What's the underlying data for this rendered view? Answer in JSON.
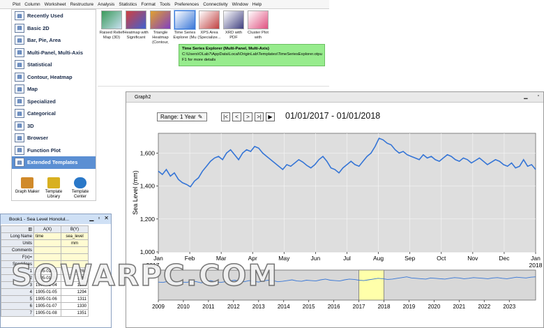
{
  "menu": [
    "Plot",
    "Column",
    "Worksheet",
    "Restructure",
    "Analysis",
    "Statistics",
    "Format",
    "Tools",
    "Preferences",
    "Connectivity",
    "Window",
    "Help"
  ],
  "categories": [
    {
      "label": "Recently Used",
      "icon": "recent-icon"
    },
    {
      "label": "Basic 2D",
      "icon": "basic2d-icon"
    },
    {
      "label": "Bar, Pie, Area",
      "icon": "bar-icon"
    },
    {
      "label": "Multi-Panel, Multi-Axis",
      "icon": "multipanel-icon"
    },
    {
      "label": "Statistical",
      "icon": "statistical-icon"
    },
    {
      "label": "Contour, Heatmap",
      "icon": "contour-icon"
    },
    {
      "label": "Map",
      "icon": "map-icon"
    },
    {
      "label": "Specialized",
      "icon": "specialized-icon"
    },
    {
      "label": "Categorical",
      "icon": "categorical-icon"
    },
    {
      "label": "3D",
      "icon": "3d-icon"
    },
    {
      "label": "Browser",
      "icon": "browser-icon"
    },
    {
      "label": "Function Plot",
      "icon": "function-icon"
    },
    {
      "label": "Extended Templates",
      "icon": "templates-icon",
      "selected": true
    }
  ],
  "bottom_buttons": [
    {
      "label": "Graph Maker",
      "icon": "graph-maker-icon"
    },
    {
      "label": "Template Library",
      "icon": "template-library-icon"
    },
    {
      "label": "Template Center",
      "icon": "template-center-icon"
    }
  ],
  "templates": [
    {
      "label": "Raised Relief Map (3D)"
    },
    {
      "label": "Heatmap with Significant"
    },
    {
      "label": "Triangle Heatmap (Contour,"
    },
    {
      "label": "Time Series Explorer (Mu",
      "selected": true
    },
    {
      "label": "XPS Area (Specialize..."
    },
    {
      "label": "XRD with PDF"
    },
    {
      "label": "Cluster Plot with"
    }
  ],
  "tooltip": {
    "title": "Time Series Explorer (Multi-Panel, Multi-Axis)",
    "path": "C:\\Users\\OLab7\\AppData\\Local\\OriginLab\\Templates\\TimeSeriesExplorer.otpu",
    "help": "F1 for more details"
  },
  "graph": {
    "title": "Graph2",
    "range_label": "Range: 1 Year",
    "date_range": "01/01/2017 - 01/01/2018",
    "nav": [
      "|<",
      "<",
      ">",
      ">|",
      "▶"
    ]
  },
  "colors": {
    "line": "#3575d6",
    "selected_cat": "#5b8fd3",
    "tooltip": "#97ec8d",
    "overview_bg": "#d8d8d8",
    "highlight": "#ffffaa"
  },
  "chart_data": [
    {
      "type": "line",
      "ylabel": "Sea Level (mm)",
      "ylim": [
        1000,
        1720
      ],
      "yticks": [
        "1,000",
        "1,200",
        "1,400",
        "1,600"
      ],
      "ytick_values": [
        1000,
        1200,
        1400,
        1600
      ],
      "x_month_labels": [
        "Jan",
        "Feb",
        "Mar",
        "Apr",
        "May",
        "Jun",
        "Jul",
        "Aug",
        "Sep",
        "Oct",
        "Nov",
        "Dec",
        "Jan"
      ],
      "x_corner_labels": {
        "left": "2017",
        "right": "2018"
      },
      "series": [
        {
          "values": [
            1490,
            1470,
            1500,
            1460,
            1480,
            1440,
            1420,
            1410,
            1395,
            1430,
            1450,
            1490,
            1520,
            1550,
            1570,
            1580,
            1560,
            1600,
            1620,
            1590,
            1560,
            1600,
            1620,
            1610,
            1640,
            1630,
            1600,
            1580,
            1560,
            1540,
            1520,
            1500,
            1530,
            1520,
            1540,
            1560,
            1545,
            1525,
            1510,
            1530,
            1560,
            1580,
            1550,
            1510,
            1500,
            1480,
            1510,
            1530,
            1550,
            1530,
            1520,
            1550,
            1580,
            1600,
            1640,
            1690,
            1680,
            1660,
            1650,
            1620,
            1600,
            1610,
            1590,
            1580,
            1570,
            1560,
            1590,
            1570,
            1580,
            1560,
            1550,
            1570,
            1590,
            1580,
            1560,
            1550,
            1570,
            1560,
            1540,
            1555,
            1570,
            1550,
            1530,
            1545,
            1560,
            1550,
            1530,
            1520,
            1540,
            1510,
            1520,
            1560,
            1520,
            1530,
            1500
          ]
        }
      ]
    },
    {
      "type": "line",
      "x_year_labels": [
        "2009",
        "2010",
        "2011",
        "2012",
        "2013",
        "2014",
        "2015",
        "2016",
        "2017",
        "2018",
        "2019",
        "2020",
        "2021",
        "2022",
        "2023"
      ],
      "highlight": {
        "from": 2017,
        "to": 2018
      },
      "ylim": [
        1000,
        1800
      ],
      "series": [
        {
          "values": [
            1480,
            1470,
            1500,
            1490,
            1460,
            1480,
            1470,
            1510,
            1490,
            1460,
            1500,
            1520,
            1480,
            1470,
            1490,
            1510,
            1530,
            1500,
            1490,
            1520,
            1500,
            1480,
            1510,
            1530,
            1520,
            1490,
            1500,
            1520,
            1540,
            1510,
            1500,
            1530,
            1520,
            1510,
            1540,
            1560,
            1530,
            1520,
            1510,
            1540,
            1560,
            1550,
            1530,
            1520,
            1540,
            1560,
            1580,
            1570,
            1550,
            1560,
            1580,
            1600,
            1620,
            1590,
            1580,
            1570,
            1560,
            1590,
            1580,
            1570,
            1560,
            1580,
            1600,
            1590,
            1570,
            1580,
            1600,
            1590,
            1580,
            1570,
            1590,
            1600,
            1580,
            1570,
            1590,
            1610,
            1600,
            1590,
            1610,
            1620
          ]
        }
      ]
    }
  ],
  "book": {
    "title": "Book1 - Sea Level Honolul...",
    "col_headers": [
      "A(X)",
      "B(Y)"
    ],
    "meta_rows": [
      {
        "label": "Long Name",
        "a": "time",
        "b": "sea_level"
      },
      {
        "label": "Units",
        "a": "",
        "b": "mm"
      },
      {
        "label": "Comments",
        "a": "",
        "b": ""
      },
      {
        "label": "F(x)=",
        "a": "",
        "b": ""
      },
      {
        "label": "Sparklines",
        "a": "",
        "b": ""
      }
    ],
    "rows": [
      {
        "n": "1",
        "a": "1905-01-01",
        "b": "1263"
      },
      {
        "n": "2",
        "a": "1905-01-03",
        "b": "1264"
      },
      {
        "n": "3",
        "a": "1905-01-04",
        "b": "1289"
      },
      {
        "n": "4",
        "a": "1905-01-05",
        "b": "1294"
      },
      {
        "n": "5",
        "a": "1905-01-06",
        "b": "1311"
      },
      {
        "n": "6",
        "a": "1905-01-07",
        "b": "1330"
      },
      {
        "n": "7",
        "a": "1905-01-08",
        "b": "1351"
      }
    ]
  },
  "watermark": "SOWARPC.COM"
}
